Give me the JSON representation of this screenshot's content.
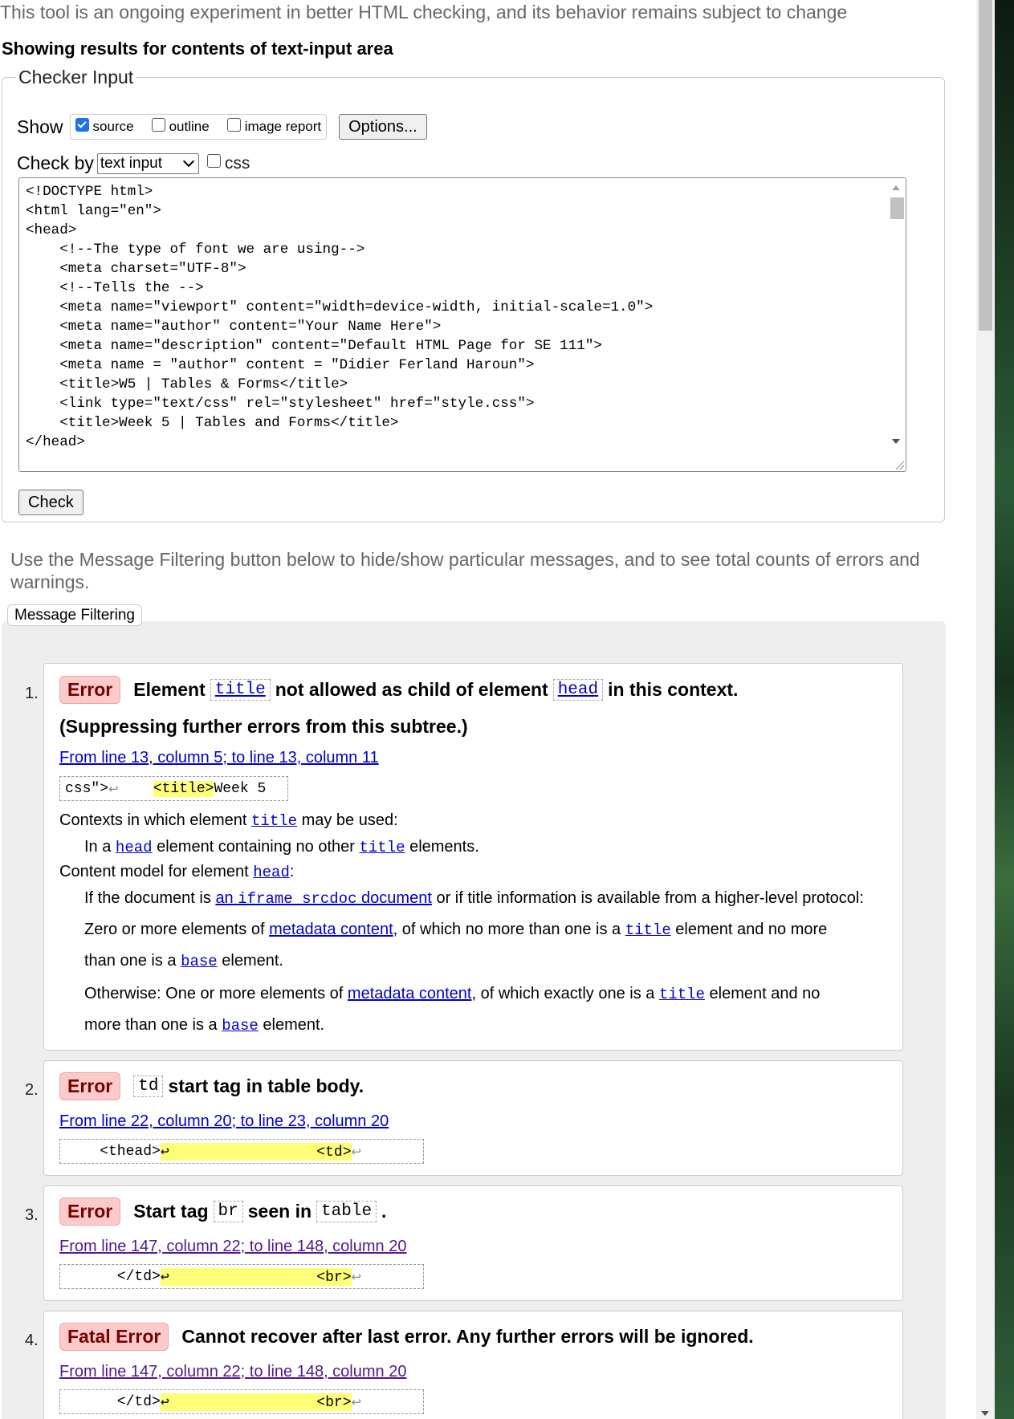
{
  "intro": "This tool is an ongoing experiment in better HTML checking, and its behavior remains subject to change",
  "results_heading": "Showing results for contents of text-input area",
  "checker": {
    "legend": "Checker Input",
    "show_label": "Show",
    "show_source": "source",
    "show_outline": "outline",
    "show_image_report": "image report",
    "options_button": "Options...",
    "check_by_label": "Check by",
    "check_by_value": "text input",
    "css_label": "css",
    "source_code": "<!DOCTYPE html>\n<html lang=\"en\">\n<head>\n    <!--The type of font we are using-->\n    <meta charset=\"UTF-8\">\n    <!--Tells the -->\n    <meta name=\"viewport\" content=\"width=device-width, initial-scale=1.0\">\n    <meta name=\"author\" content=\"Your Name Here\">\n    <meta name=\"description\" content=\"Default HTML Page for SE 111\">\n    <meta name = \"author\" content = \"Didier Ferland Haroun\">\n    <title>W5 | Tables & Forms</title>\n    <link type=\"text/css\" rel=\"stylesheet\" href=\"style.css\">\n    <title>Week 5 | Tables and Forms</title>\n</head>",
    "check_button": "Check"
  },
  "filter_note": "Use the Message Filtering button below to hide/show particular messages, and to see total counts of errors and warnings.",
  "filter_button": "Message Filtering",
  "messages": [
    {
      "num": "1.",
      "badge": "Error",
      "t1": "Element",
      "c1": "title",
      "t2": "not allowed as child of element",
      "c2": "head",
      "t3": "in this context.",
      "line2": "(Suppressing further errors from this subtree.)",
      "location": "From line 13, column 5; to line 13, column 11",
      "extract_pre": "css\">",
      "extract_lf": "↩",
      "extract_gap": "    ",
      "extract_hl": "<title>",
      "extract_post": "Week 5",
      "details": {
        "ctx_heading": "Contexts in which element",
        "ctx_code": "title",
        "ctx_tail": "may be used:",
        "ctx_a": "In a",
        "ctx_head": "head",
        "ctx_b": "element containing no other",
        "ctx_title": "title",
        "ctx_c": "elements.",
        "cm_heading": "Content model for element",
        "cm_code": "head",
        "cm_colon": ":",
        "if_a": "If the document is",
        "if_link_pre": "an",
        "if_link_code": "iframe srcdoc",
        "if_link_post": "document",
        "if_b": "or if title information is available from a higher-level protocol:",
        "zero_a": "Zero or more elements of",
        "zero_link": "metadata content",
        "zero_b": ", of which no more than one is a",
        "zero_title": "title",
        "zero_c": "element and no more",
        "zero_d": "than one is a",
        "zero_base": "base",
        "zero_e": "element.",
        "other_a": "Otherwise: One or more elements of",
        "other_link": "metadata content",
        "other_b": ", of which exactly one is a",
        "other_title": "title",
        "other_c": "element and no",
        "other_d": "more than one is a",
        "other_base": "base",
        "other_e": "element."
      }
    },
    {
      "num": "2.",
      "badge": "Error",
      "c1": "td",
      "t1": "start tag in table body.",
      "location": "From line 22, column 20; to line 23, column 20",
      "extract_pre": "    <thead>",
      "extract_hl": "↩                 ",
      "extract_post_hl": "<td>",
      "extract_lf": "↩"
    },
    {
      "num": "3.",
      "badge": "Error",
      "t1": "Start tag",
      "c1": "br",
      "t2": "seen in",
      "c2": "table",
      "t3": ".",
      "location": "From line 147, column 22; to line 148, column 20",
      "extract_pre": "      </td>",
      "extract_hl": "↩                 ",
      "extract_post_hl": "<br>",
      "extract_lf": "↩"
    },
    {
      "num": "4.",
      "badge": "Fatal Error",
      "t1": "Cannot recover after last error. Any further errors will be ignored.",
      "location": "From line 147, column 22; to line 148, column 20",
      "extract_pre": "      </td>",
      "extract_hl": "↩                 ",
      "extract_post_hl": "<br>",
      "extract_lf": "↩"
    }
  ]
}
